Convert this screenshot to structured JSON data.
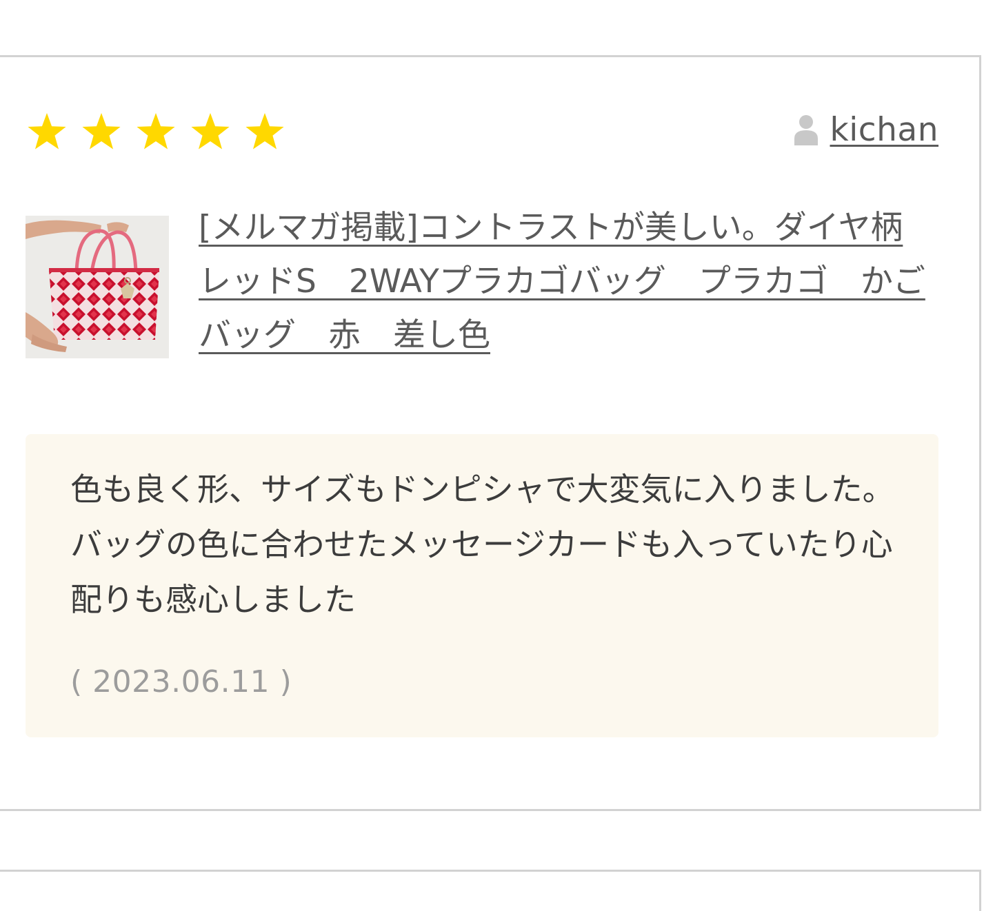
{
  "review": {
    "rating": 5,
    "rating_max": 5,
    "star_color": "#ffd800",
    "reviewer": {
      "name": "kichan",
      "icon": "user-icon"
    },
    "product": {
      "title": "[メルマガ掲載]コントラストが美しい。ダイヤ柄レッドS　2WAYプラカゴバッグ　プラカゴ　かごバッグ　赤　差し色",
      "thumbnail_icon": "red-diamond-pattern-bag-photo"
    },
    "comment": "色も良く形、サイズもドンピシャで大変気に入りました。バッグの色に合わせたメッセージカードも入っていたり心配りも感心しました",
    "date": "( 2023.06.11 )",
    "comment_background": "#fcf8ee"
  }
}
